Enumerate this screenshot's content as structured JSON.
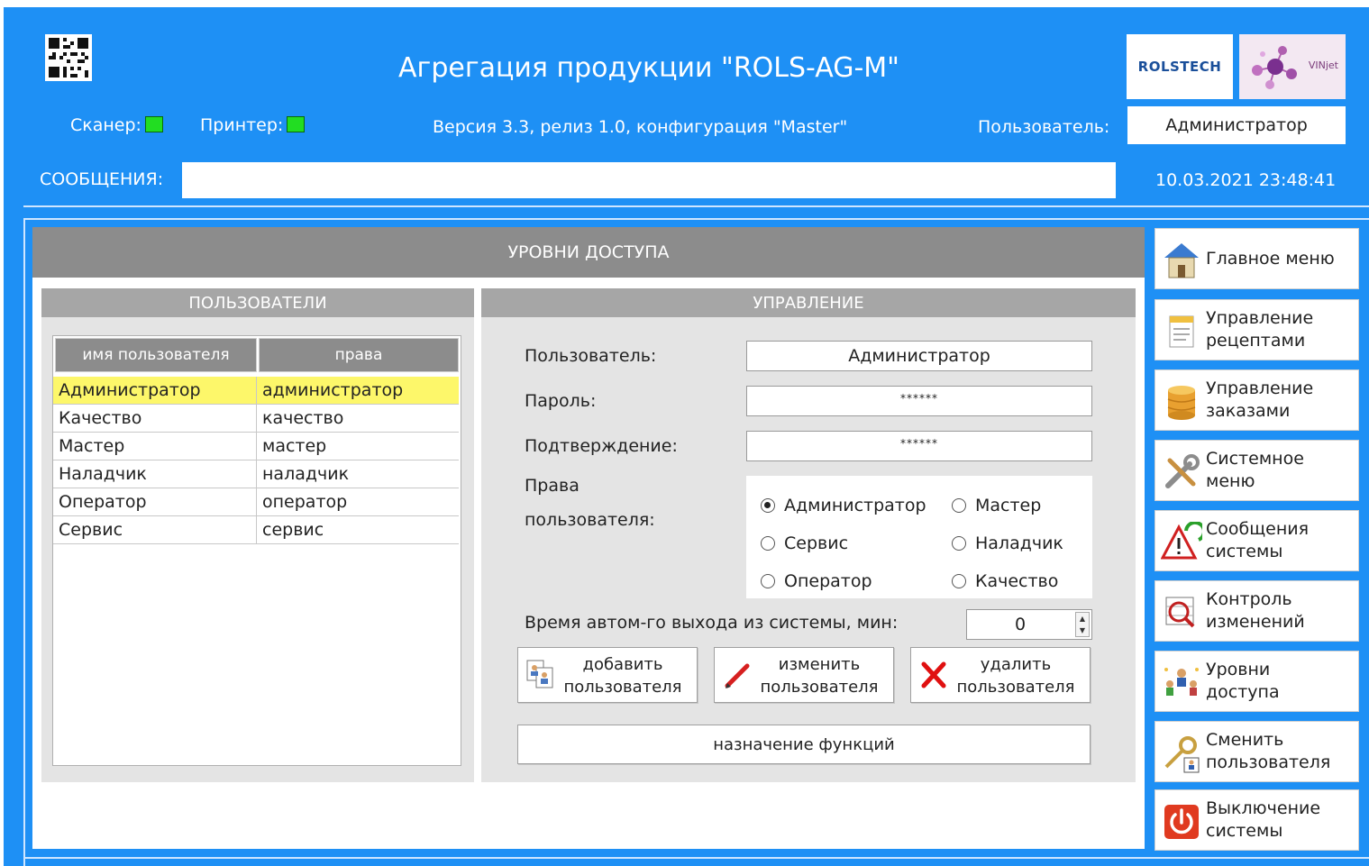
{
  "header": {
    "title": "Агрегация продукции \"ROLS-AG-M\"",
    "scanner_label": "Сканер:",
    "printer_label": "Принтер:",
    "version": "Версия 3.3, релиз 1.0, конфигурация \"Master\"",
    "user_label": "Пользователь:",
    "user_value": "Администратор",
    "messages_label": "СООБЩЕНИЯ:",
    "messages_value": "",
    "datetime": "10.03.2021 23:48:41",
    "logo_rols": "ROLSTECH",
    "logo_vinjet": "VINjet",
    "status_color": "#22dd22"
  },
  "main": {
    "title": "УРОВНИ ДОСТУПА",
    "users_panel": {
      "title": "ПОЛЬЗОВАТЕЛИ",
      "columns": [
        "имя пользователя",
        "права"
      ],
      "rows": [
        [
          "Администратор",
          "администратор"
        ],
        [
          "Качество",
          "качество"
        ],
        [
          "Мастер",
          "мастер"
        ],
        [
          "Наладчик",
          "наладчик"
        ],
        [
          "Оператор",
          "оператор"
        ],
        [
          "Сервис",
          "сервис"
        ]
      ],
      "selected_row": 0
    },
    "control_panel": {
      "title": "УПРАВЛЕНИЕ",
      "user_label": "Пользователь:",
      "user_value": "Администратор",
      "password_label": "Пароль:",
      "password_value": "******",
      "confirm_label": "Подтверждение:",
      "confirm_value": "******",
      "rights_label_1": "Права",
      "rights_label_2": "пользователя:",
      "rights": [
        {
          "label": "Администратор",
          "checked": true
        },
        {
          "label": "Мастер",
          "checked": false
        },
        {
          "label": "Сервис",
          "checked": false
        },
        {
          "label": "Наладчик",
          "checked": false
        },
        {
          "label": "Оператор",
          "checked": false
        },
        {
          "label": "Качество",
          "checked": false
        }
      ],
      "autologout_label": "Время автом-го выхода из системы, мин:",
      "autologout_value": "0",
      "add_button": [
        "добавить",
        "пользователя"
      ],
      "edit_button": [
        "изменить",
        "пользователя"
      ],
      "delete_button": [
        "удалить",
        "пользователя"
      ],
      "assign_button": "назначение функций"
    }
  },
  "nav": [
    {
      "icon": "home-icon",
      "lines": [
        "Главное меню"
      ]
    },
    {
      "icon": "recipe-document-icon",
      "lines": [
        "Управление",
        "рецептами"
      ]
    },
    {
      "icon": "database-icon",
      "lines": [
        "Управление",
        "заказами"
      ]
    },
    {
      "icon": "tools-icon",
      "lines": [
        "Системное",
        "меню"
      ]
    },
    {
      "icon": "warning-refresh-icon",
      "lines": [
        "Сообщения",
        "системы"
      ]
    },
    {
      "icon": "magnifier-table-icon",
      "lines": [
        "Контроль",
        "изменений"
      ]
    },
    {
      "icon": "users-network-icon",
      "lines": [
        "Уровни",
        "доступа"
      ]
    },
    {
      "icon": "key-user-icon",
      "lines": [
        "Сменить",
        "пользователя"
      ]
    },
    {
      "icon": "power-icon",
      "lines": [
        "Выключение",
        "системы"
      ]
    }
  ]
}
